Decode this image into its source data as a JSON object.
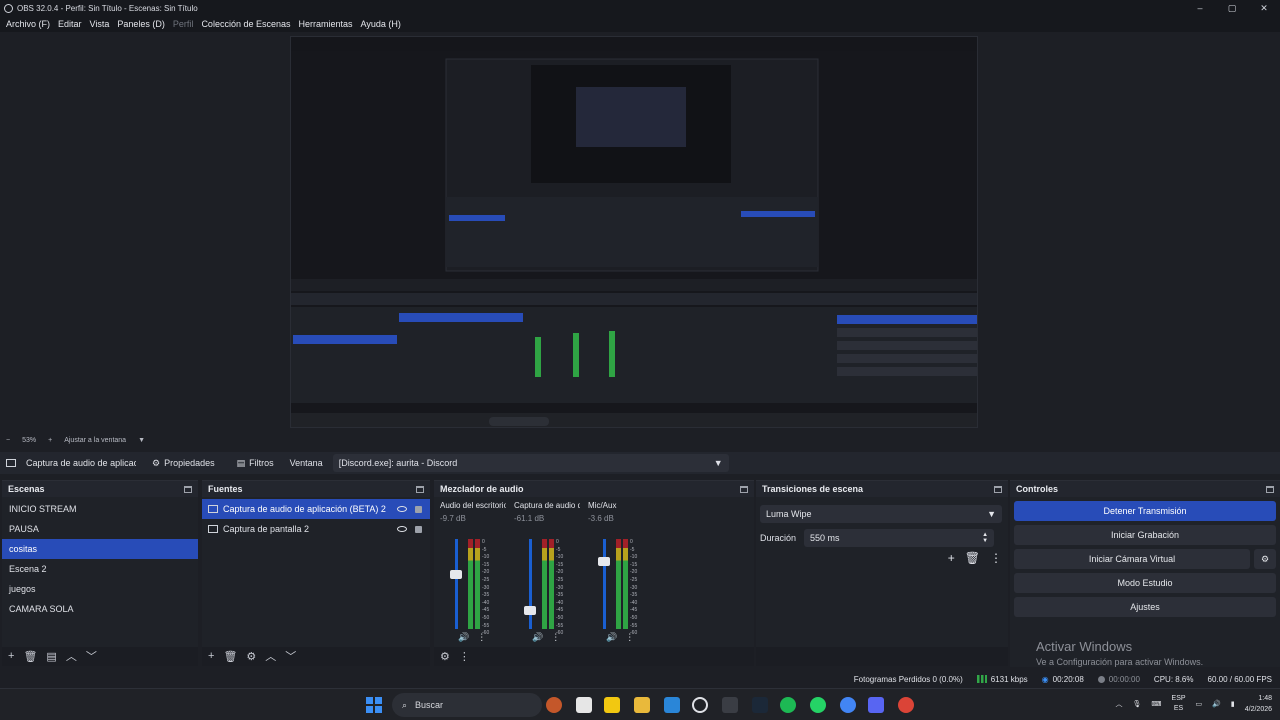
{
  "window": {
    "title": "OBS 32.0.4 - Perfil: Sin Título - Escenas: Sin Título",
    "controls": [
      "–",
      "▢",
      "✕"
    ]
  },
  "menu": {
    "items": [
      {
        "label": "Archivo (F)"
      },
      {
        "label": "Editar"
      },
      {
        "label": "Vista"
      },
      {
        "label": "Paneles (D)"
      },
      {
        "label": "Perfil",
        "disabled": true
      },
      {
        "label": "Colección de Escenas"
      },
      {
        "label": "Herramientas"
      },
      {
        "label": "Ayuda (H)"
      }
    ]
  },
  "preview": {
    "zoom_minus": "−",
    "zoom_value": "53%",
    "zoom_plus": "+",
    "fit_label": "Ajustar a la ventana"
  },
  "source_toolbar": {
    "source_name": "Captura de audio de aplicac",
    "properties_label": "Propiedades",
    "filters_label": "Filtros",
    "window_label": "Ventana",
    "window_value": "[Discord.exe]: aurita - Discord"
  },
  "scenes": {
    "title": "Escenas",
    "items": [
      "INICIO STREAM",
      "PAUSA",
      "cositas",
      "Escena 2",
      "juegos",
      "CAMARA SOLA"
    ],
    "selected": 2
  },
  "sources": {
    "title": "Fuentes",
    "items": [
      {
        "label": "Captura de audio de aplicación (BETA) 2",
        "icon": "app-audio-icon"
      },
      {
        "label": "Captura de pantalla 2",
        "icon": "monitor-icon"
      }
    ],
    "selected": 0
  },
  "mixer": {
    "title": "Mezclador de audio",
    "channels": [
      {
        "name": "Audio del escritorio",
        "db": "-9.7 dB",
        "fader_level": 0.62
      },
      {
        "name": "Captura de audio d",
        "db": "-61.1 dB",
        "fader_level": 0.18
      },
      {
        "name": "Mic/Aux",
        "db": "-3.6 dB",
        "fader_level": 0.78
      }
    ],
    "scale": [
      "0",
      "-5",
      "-10",
      "-15",
      "-20",
      "-25",
      "-30",
      "-35",
      "-40",
      "-45",
      "-50",
      "-55",
      "-60"
    ]
  },
  "transitions": {
    "title": "Transiciones de escena",
    "selected": "Luma Wipe",
    "duration_label": "Duración",
    "duration_value": "550 ms"
  },
  "controls": {
    "title": "Controles",
    "buttons": [
      "Detener Transmisión",
      "Iniciar Grabación",
      "Iniciar Cámara Virtual",
      "Modo Estudio",
      "Ajustes"
    ],
    "activate_title": "Activar Windows",
    "activate_sub": "Ve a Configuración para activar Windows."
  },
  "status": {
    "dropped": "Fotogramas Perdidos 0 (0.0%)",
    "bitrate": "6131 kbps",
    "stream_time": "00:20:08",
    "rec_time": "00:00:00",
    "cpu": "CPU: 8.6%",
    "fps": "60.00 / 60.00 FPS"
  },
  "taskbar": {
    "search_placeholder": "Buscar",
    "lang_top": "ESP",
    "lang_bottom": "ES",
    "time": "1:48",
    "date": "4/2/2026"
  },
  "colors": {
    "accent": "#284cb8",
    "bg": "#1d1f25",
    "panel": "#1f2228"
  }
}
